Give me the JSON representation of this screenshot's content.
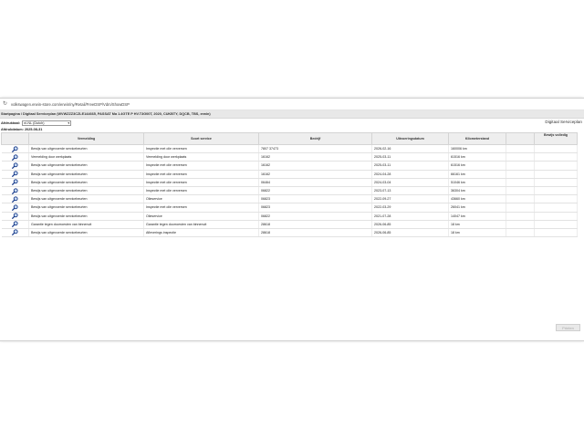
{
  "browser": {
    "url": "volkswagen.erwin-store.com/erwin/ny/Retail/FreeDSP/Vdm/ShowDSP"
  },
  "breadcrumb": "Startpagina / Digitaal Serviceplan (WVWZZZ3CZLE144665, PASSAT Ma 1.4GTE P HV.T3G00T, 2020, CUKBTY, DQCB, TBS, erwin)",
  "toolbar": {
    "language_label": "Afdruktaal:",
    "language_value": "nl-NL (Dutch)"
  },
  "page_title": "Digitaal Serviceplan",
  "date_line": "Afdrukdatum: 2025-08-31",
  "table": {
    "headers": [
      "",
      "Vermelding",
      "Soort service",
      "Bedrijf",
      "Uitvoeringsdatum",
      "Kilometerstand",
      "",
      "Bewijs volledig"
    ],
    "rows": [
      [
        "Bewijs van uitgevoerde servicebeurten",
        "Inspectie met olie verversen",
        "7807 37473",
        "2026-02-16",
        "160006 km"
      ],
      [
        "Vermelding door werkplaats",
        "Vermelding door werkplaats",
        "16162",
        "2025-03-11",
        "61516 km"
      ],
      [
        "Bewijs van uitgevoerde servicebeurten",
        "Inspectie met olie verversen",
        "16162",
        "2025-03-11",
        "61516 km"
      ],
      [
        "Bewijs van uitgevoerde servicebeurten",
        "Inspectie met olie verversen",
        "16162",
        "2024-04-28",
        "66161 km"
      ],
      [
        "Bewijs van uitgevoerde servicebeurten",
        "Inspectie met olie verversen",
        "06464",
        "2024-03-04",
        "51046 km"
      ],
      [
        "Bewijs van uitgevoerde servicebeurten",
        "Inspectie met olie verversen",
        "06822",
        "2023-07-13",
        "36304 km"
      ],
      [
        "Bewijs van uitgevoerde servicebeurten",
        "Olieservice",
        "06823",
        "2022-09-27",
        "43660 km"
      ],
      [
        "Bewijs van uitgevoerde servicebeurten",
        "Inspectie met olie verversen",
        "06823",
        "2022-03-29",
        "26041 km"
      ],
      [
        "Bewijs van uitgevoerde servicebeurten",
        "Olieservice",
        "06822",
        "2021-07-28",
        "14047 km"
      ],
      [
        "Garantie tegen doorroesten van binnenuit",
        "Garantie tegen doorroesten van binnenuit",
        "28618",
        "2026-06-85",
        "18 km"
      ],
      [
        "Bewijs van uitgevoerde servicebeurten",
        "Afleverings inspectie",
        "28618",
        "2026-06-85",
        "18 km"
      ]
    ]
  },
  "print_button": "Printen",
  "icons": {
    "reload": "reload-icon",
    "row": "magnifier-icon"
  },
  "colors": {
    "magnifier": "#1a3d8c",
    "header_bg": "#eeeeee"
  }
}
